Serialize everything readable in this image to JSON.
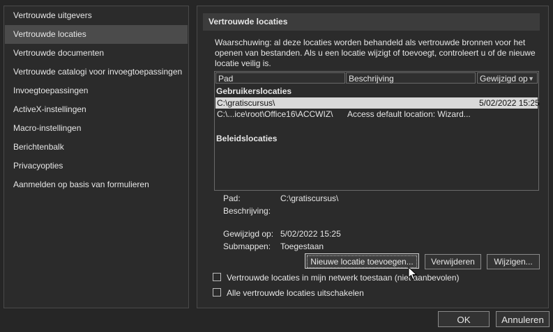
{
  "sidebar": {
    "items": [
      {
        "label": "Vertrouwde uitgevers"
      },
      {
        "label": "Vertrouwde locaties"
      },
      {
        "label": "Vertrouwde documenten"
      },
      {
        "label": "Vertrouwde catalogi voor invoegtoepassingen"
      },
      {
        "label": "Invoegtoepassingen"
      },
      {
        "label": "ActiveX-instellingen"
      },
      {
        "label": "Macro-instellingen"
      },
      {
        "label": "Berichtenbalk"
      },
      {
        "label": "Privacyopties"
      },
      {
        "label": "Aanmelden op basis van formulieren"
      }
    ]
  },
  "main": {
    "section_title": "Vertrouwde locaties",
    "warning": "Waarschuwing: al deze locaties worden behandeld als vertrouwde bronnen voor het openen van bestanden. Als u een locatie wijzigt of toevoegt, controleert u of de nieuwe locatie veilig is.",
    "table": {
      "columns": [
        "Pad",
        "Beschrijving",
        "Gewijzigd op"
      ],
      "user_group": "Gebruikerslocaties",
      "user_rows": [
        {
          "path": "C:\\gratiscursus\\",
          "description": "",
          "modified": "5/02/2022 15:25"
        },
        {
          "path": "C:\\...ice\\root\\Office16\\ACCWIZ\\",
          "description": "Access default location: Wizard...",
          "modified": ""
        }
      ],
      "policy_group": "Beleidslocaties"
    },
    "details": {
      "path_label": "Pad:",
      "path_value": "C:\\gratiscursus\\",
      "description_label": "Beschrijving:",
      "description_value": "",
      "modified_label": "Gewijzigd op:",
      "modified_value": "5/02/2022 15:25",
      "subfolders_label": "Submappen:",
      "subfolders_value": "Toegestaan"
    },
    "buttons": {
      "add": "Nieuwe locatie toevoegen...",
      "remove": "Verwijderen",
      "modify": "Wijzigen..."
    },
    "checkboxes": {
      "network": {
        "label": "Vertrouwde locaties in mijn netwerk toestaan (niet aanbevolen)",
        "checked": false
      },
      "disable_all": {
        "label": "Alle vertrouwde locaties uitschakelen",
        "checked": false
      }
    }
  },
  "footer": {
    "ok": "OK",
    "cancel": "Annuleren"
  },
  "colors": {
    "background": "#262626",
    "panel": "#2b2b2b",
    "selected_row": "#d9d9d9",
    "active_nav": "#4b4b4b"
  }
}
